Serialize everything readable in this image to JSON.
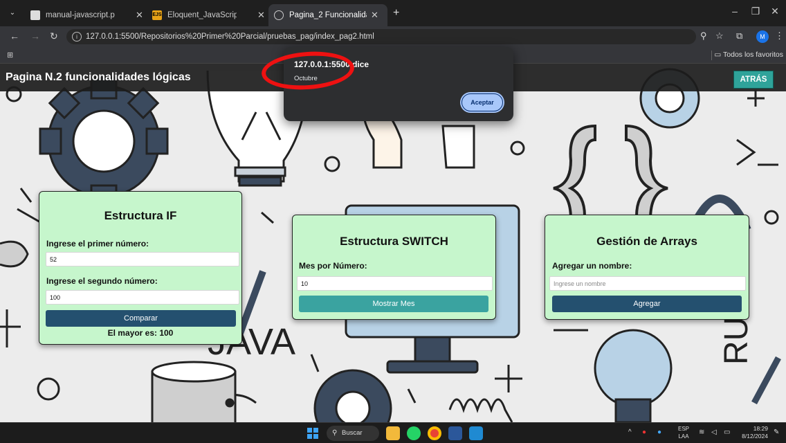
{
  "browser": {
    "tabs": [
      {
        "label": "manual-javascript.pdf",
        "active": false
      },
      {
        "label": "Eloquent_JavaScript.pdf",
        "active": false,
        "favicon_text": "EJS"
      },
      {
        "label": "Pagina_2 Funcionalidades Lógic",
        "active": true
      }
    ],
    "url": "127.0.0.1:5500/Repositorios%20Primer%20Parcial/pruebas_pag/index_pag2.html",
    "bookmarks_folder": "Todos los favoritos",
    "profile_initial": "M"
  },
  "page": {
    "header_title": "Pagina N.2 funcionalidades lógicas",
    "back_button": "ATRÁS",
    "if_card": {
      "title": "Estructura IF",
      "label_first": "Ingrese el primer número:",
      "value_first": "52",
      "label_second": "Ingrese el segundo número:",
      "value_second": "100",
      "button": "Comparar",
      "result": "El mayor es: 100"
    },
    "switch_card": {
      "title": "Estructura SWITCH",
      "label": "Mes por Número:",
      "value": "10",
      "button": "Mostrar Mes"
    },
    "arrays_card": {
      "title": "Gestión de Arrays",
      "label": "Agregar un nombre:",
      "placeholder": "Ingrese un nombre",
      "button": "Agregar"
    },
    "background_text": [
      "JAVA",
      "RU"
    ]
  },
  "alert": {
    "origin": "127.0.0.1:5500 dice",
    "message": "Octubre",
    "ok_button": "Aceptar"
  },
  "taskbar": {
    "search": "Buscar",
    "lang_top": "ESP",
    "lang_bottom": "LAA",
    "time": "18:29",
    "date": "8/12/2024"
  },
  "colors": {
    "card_bg": "#c6f6cc",
    "dark_button": "#24506f",
    "teal_button": "#3aa3a0",
    "back_button": "#2fa39a",
    "alert_ok": "#a8c7fa",
    "annotation": "#ee1111"
  }
}
